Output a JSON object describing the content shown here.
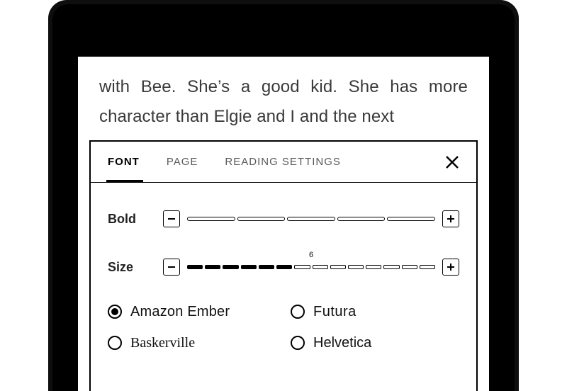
{
  "book": {
    "visible_text": "with Bee. She’s a good kid. She has more character than Elgie and I and the next"
  },
  "panel": {
    "tabs": {
      "font": "FONT",
      "page": "PAGE",
      "reading_settings": "READING SETTINGS",
      "active": "font"
    },
    "bold": {
      "label": "Bold",
      "segments": 5,
      "value": 0
    },
    "size": {
      "label": "Size",
      "segments": 14,
      "value": 6,
      "value_label": "6"
    },
    "fonts": [
      {
        "name": "Amazon Ember",
        "family": "ember",
        "selected": true
      },
      {
        "name": "Futura",
        "family": "futura",
        "selected": false
      },
      {
        "name": "Baskerville",
        "family": "serif",
        "selected": false
      },
      {
        "name": "Helvetica",
        "family": "helv",
        "selected": false
      }
    ]
  }
}
